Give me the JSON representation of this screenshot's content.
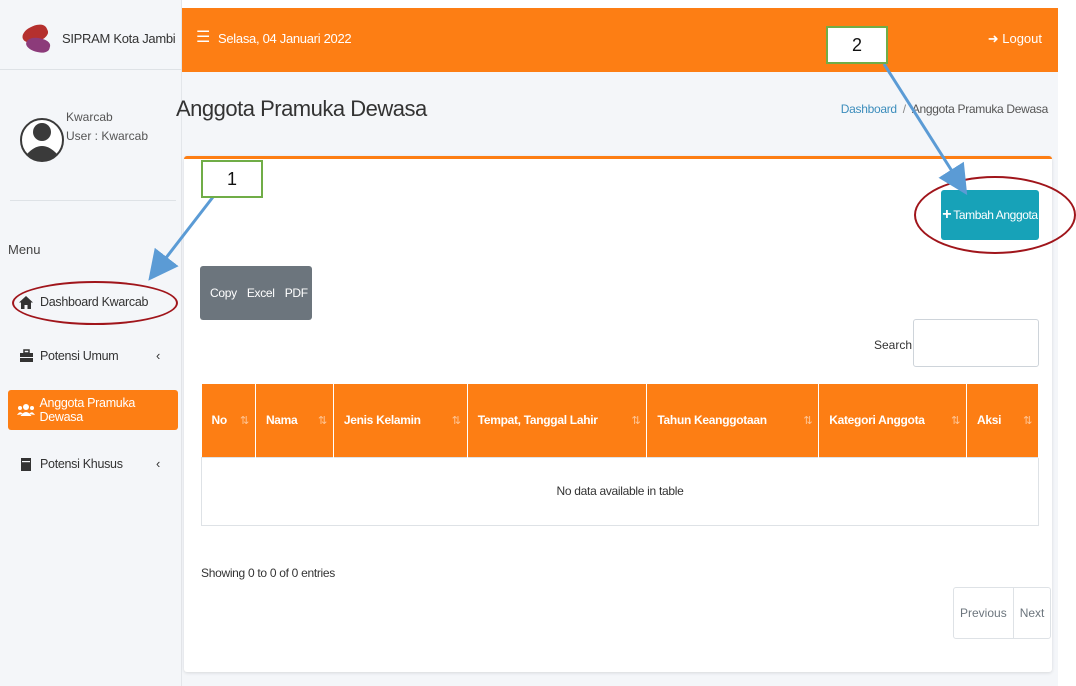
{
  "brand": {
    "name": "SIPRAM Kota Jambi"
  },
  "user": {
    "name": "Kwarcab",
    "role": "User : Kwarcab"
  },
  "sidebar": {
    "menu_header": "Menu",
    "items": [
      {
        "label": "Dashboard Kwarcab",
        "icon": "home-icon"
      },
      {
        "label": "Potensi Umum",
        "icon": "briefcase-icon",
        "chevron": "‹"
      },
      {
        "label": "Anggota Pramuka Dewasa",
        "icon": "users-icon",
        "active": true
      },
      {
        "label": "Potensi Khusus",
        "icon": "book-icon",
        "chevron": "‹"
      }
    ]
  },
  "topbar": {
    "date": "Selasa, 04 Januari 2022",
    "logout": "Logout"
  },
  "page": {
    "title": "Anggota Pramuka Dewasa",
    "breadcrumb": {
      "home": "Dashboard",
      "separator": "/",
      "current": "Anggota Pramuka Dewasa"
    }
  },
  "toolbar": {
    "add_label": "Tambah Anggota",
    "export": [
      "Copy",
      "Excel",
      "PDF"
    ],
    "search_label": "Search:",
    "search_value": ""
  },
  "table": {
    "columns": [
      "No",
      "Nama",
      "Jenis Kelamin",
      "Tempat, Tanggal Lahir",
      "Tahun Keanggotaan",
      "Kategori Anggota",
      "Aksi"
    ],
    "empty_message": "No data available in table"
  },
  "footer": {
    "info": "Showing 0 to 0 of 0 entries",
    "pagination": {
      "previous": "Previous",
      "next": "Next"
    }
  },
  "annotations": {
    "callout1": "1",
    "callout2": "2"
  },
  "colors": {
    "accent": "#fd7e14",
    "info": "#17a2b8",
    "secondary": "#6c757d",
    "highlight": "#a0151b",
    "callout_border": "#70ad47",
    "arrow": "#5b9bd5"
  }
}
